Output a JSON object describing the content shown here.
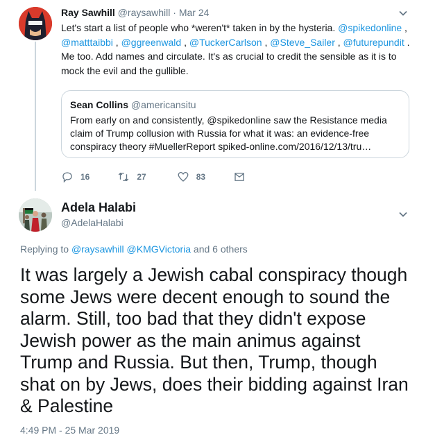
{
  "quoted_tweet": {
    "author_name": "Ray Sawhill",
    "author_handle": "@raysawhill",
    "date": "· Mar 24",
    "body_parts": [
      {
        "text": "Let's start a list of people who *weren't* taken in by the hysteria. ",
        "link": false
      },
      {
        "text": "@spikedonline",
        "link": true
      },
      {
        "text": " , ",
        "link": false
      },
      {
        "text": "@matttaibbi",
        "link": true
      },
      {
        "text": " , ",
        "link": false
      },
      {
        "text": "@ggreenwald",
        "link": true
      },
      {
        "text": " , ",
        "link": false
      },
      {
        "text": "@TuckerCarlson",
        "link": true
      },
      {
        "text": " , ",
        "link": false
      },
      {
        "text": "@Steve_Sailer",
        "link": true
      },
      {
        "text": " , ",
        "link": false
      },
      {
        "text": "@futurepundit",
        "link": true
      },
      {
        "text": " . Me too. Add names and circulate. It's as crucial to credit the sensible as it is to mock the evil and the gullible.",
        "link": false
      }
    ],
    "embedded": {
      "author_name": "Sean Collins",
      "author_handle": "@americansitu",
      "body": "From early on and consistently, @spikedonline saw the Resistance media claim of Trump collusion with Russia for what it was: an evidence-free conspiracy theory #MuellerReport spiked-online.com/2016/12/13/tru…"
    },
    "actions": {
      "replies": "16",
      "retweets": "27",
      "likes": "83"
    }
  },
  "main_tweet": {
    "author_name": "Adela Halabi",
    "author_handle": "@AdelaHalabi",
    "replying_prefix": "Replying to ",
    "replying_to_1": "@raysawhill",
    "replying_to_2": "@KMGVictoria",
    "replying_suffix": " and 6 others",
    "text": "It was largely a Jewish cabal conspiracy though some Jews were decent enough to sound the alarm. Still, too bad that they didn't expose Jewish power as the main animus against Trump and Russia. But then, Trump, though shat on by Jews, does their bidding against Iran & Palestine",
    "timestamp": "4:49 PM - 25 Mar 2019"
  },
  "colors": {
    "link": "#1b95e0",
    "secondary_text": "#657786",
    "border": "#ccd6dd"
  },
  "icons": [
    "reply-icon",
    "retweet-icon",
    "like-icon",
    "message-icon",
    "chevron-down-icon"
  ]
}
